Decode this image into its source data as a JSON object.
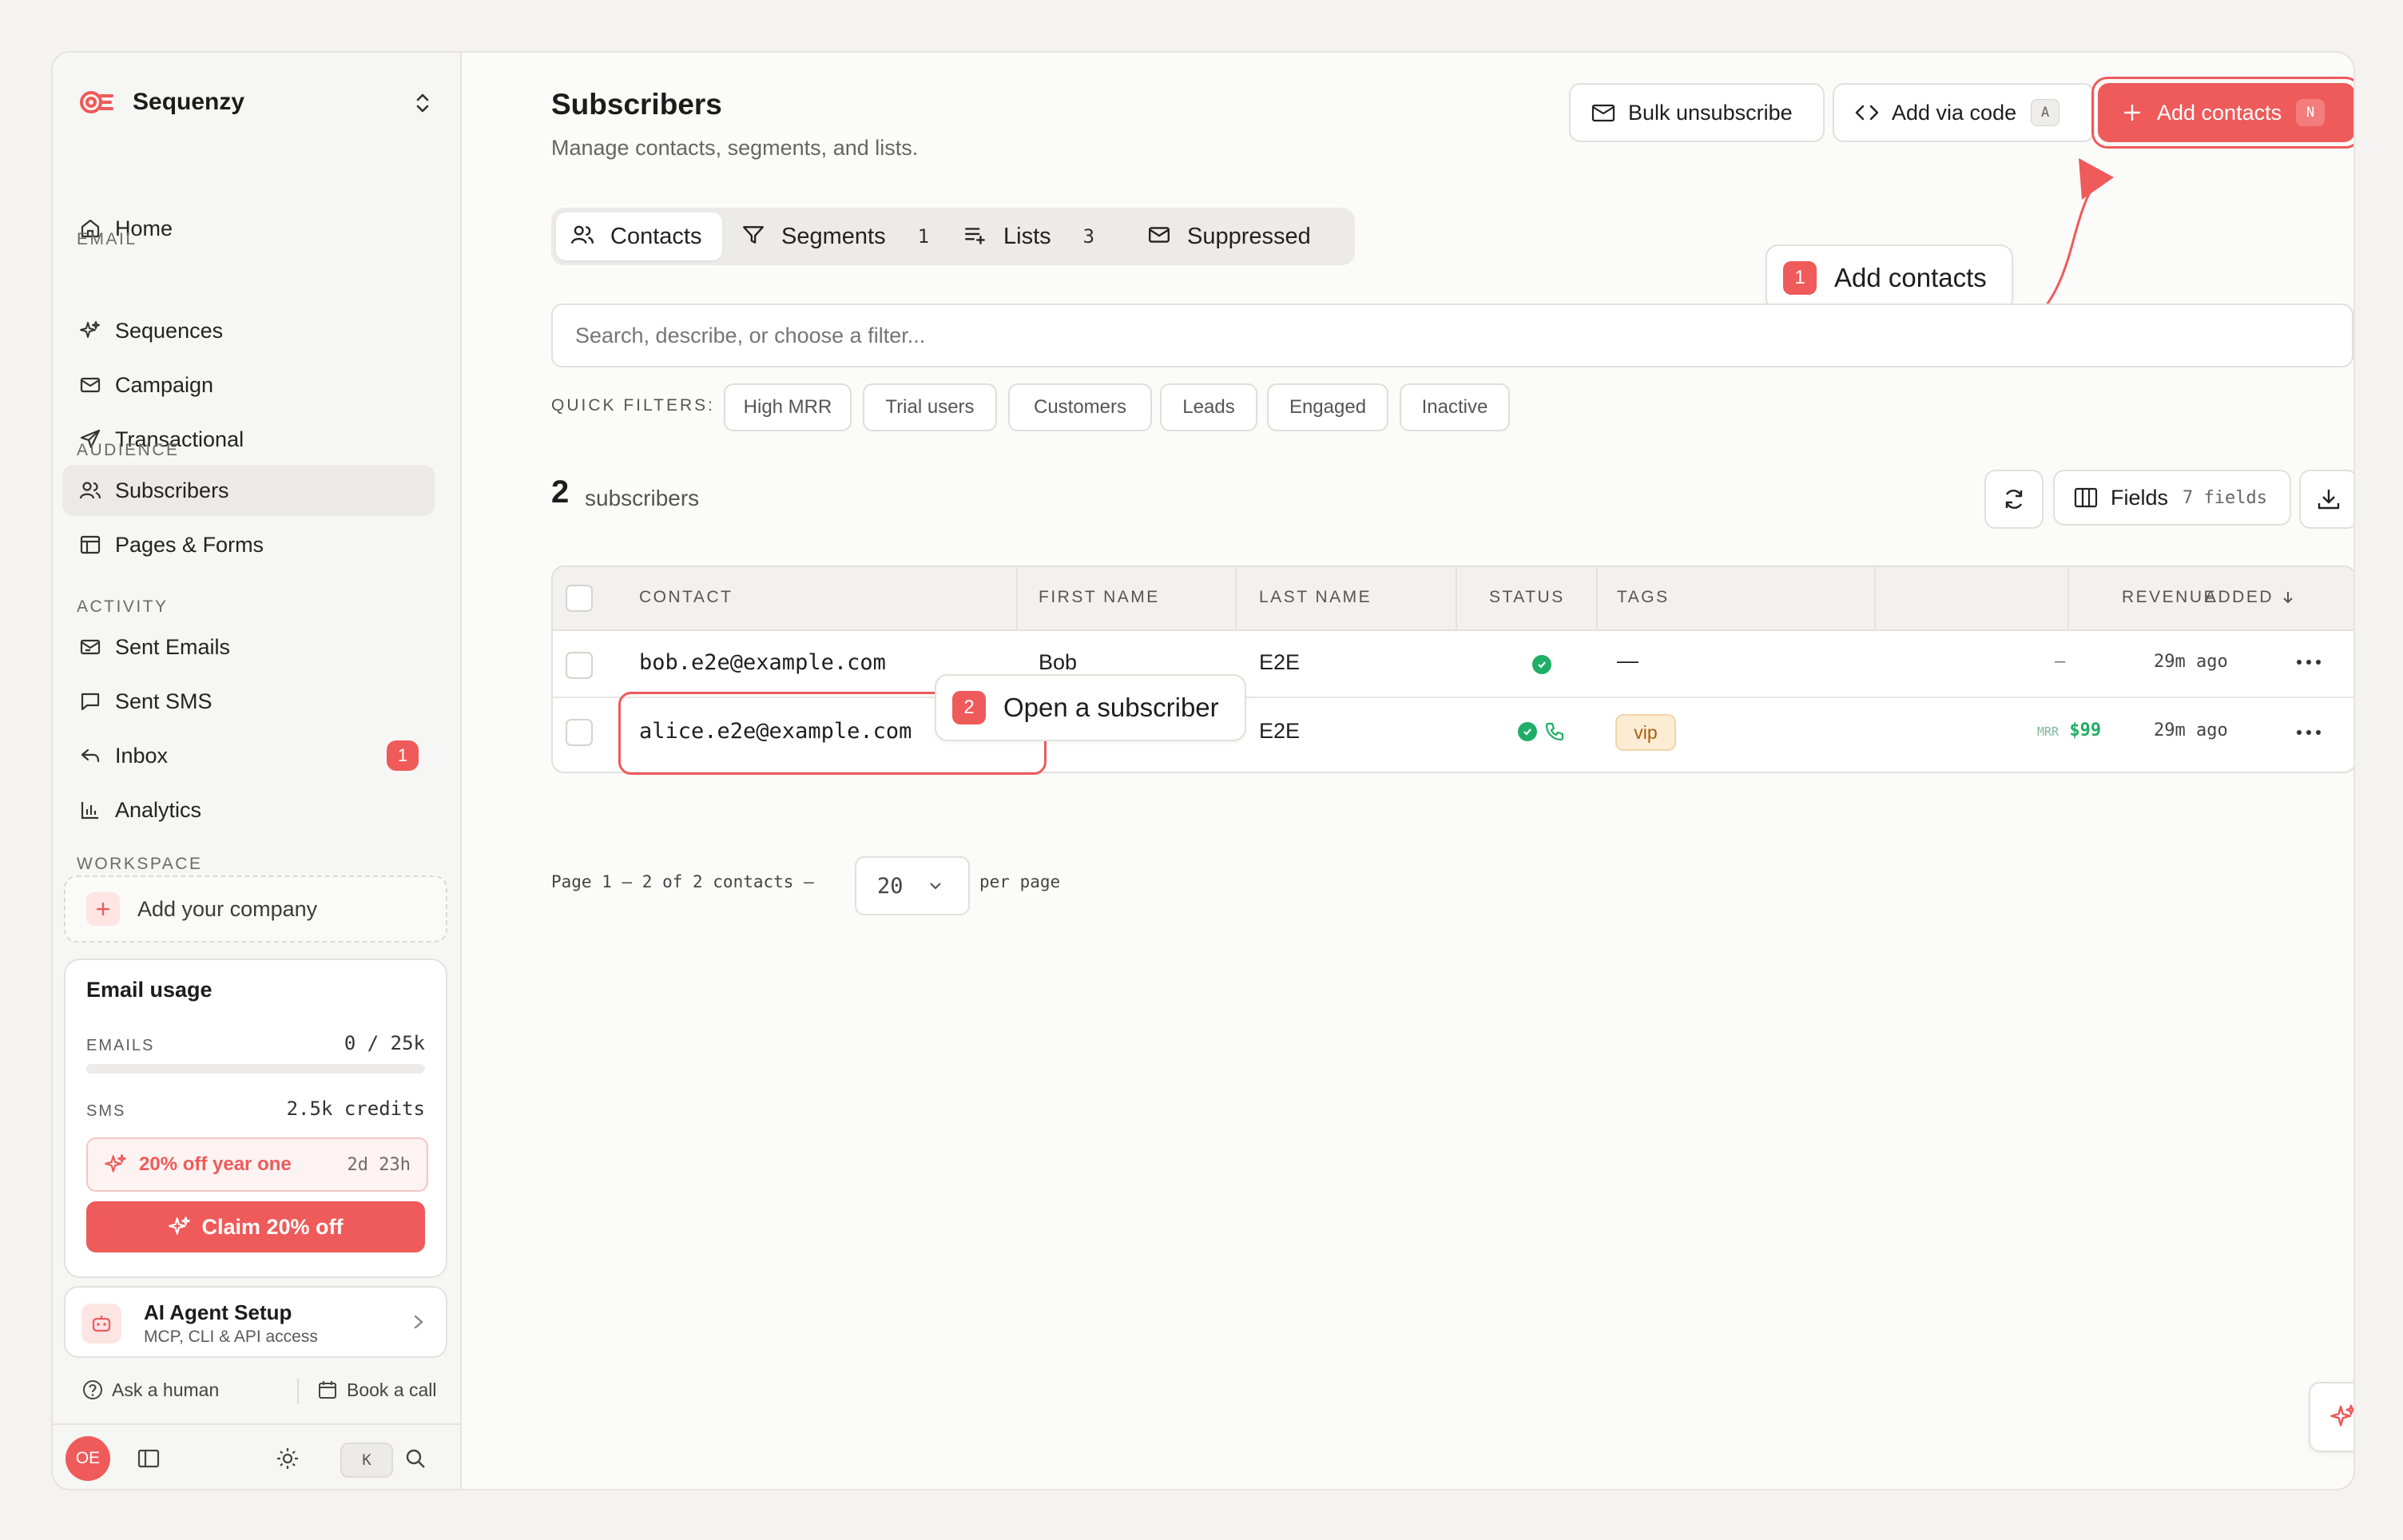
{
  "sidebar": {
    "brand": "Sequenzy",
    "home_label": "Home",
    "sections": [
      "EMAIL",
      "AUDIENCE",
      "ACTIVITY",
      "WORKSPACE"
    ],
    "email_items": [
      "Sequences",
      "Campaign",
      "Transactional"
    ],
    "audience_items": [
      "Subscribers",
      "Pages & Forms"
    ],
    "activity_items": [
      "Sent Emails",
      "Sent SMS",
      "Inbox",
      "Analytics"
    ],
    "inbox_badge": "1",
    "active_item": "Subscribers",
    "add_company": "Add your company",
    "usage": {
      "title": "Email usage",
      "emails_label": "EMAILS",
      "emails_value": "0 / 25k",
      "emails_progress": 0,
      "sms_label": "SMS",
      "sms_value": "2.5k credits",
      "promo_text": "20% off year one",
      "promo_timer": "2d 23h",
      "claim_label": "Claim 20% off"
    },
    "ai_setup": {
      "title": "AI Agent Setup",
      "subtitle": "MCP, CLI & API access"
    },
    "ask_human": "Ask a human",
    "book_call": "Book a call",
    "avatar": "OE",
    "kbd_hint": "K"
  },
  "header": {
    "title": "Subscribers",
    "subtitle": "Manage contacts, segments, and lists.",
    "bulk_unsubscribe": "Bulk unsubscribe",
    "add_via_code": "Add via code",
    "add_via_code_key": "A",
    "add_contacts": "Add contacts",
    "add_contacts_key": "N"
  },
  "tabs": [
    {
      "label": "Contacts",
      "count": ""
    },
    {
      "label": "Segments",
      "count": "1"
    },
    {
      "label": "Lists",
      "count": "3"
    },
    {
      "label": "Suppressed",
      "count": ""
    }
  ],
  "callouts": {
    "one_num": "1",
    "one_text": "Add contacts",
    "two_num": "2",
    "two_text": "Open a subscriber"
  },
  "search": {
    "placeholder": "Search, describe, or choose a filter..."
  },
  "quick_filters": {
    "label": "QUICK FILTERS:",
    "items": [
      "High MRR",
      "Trial users",
      "Customers",
      "Leads",
      "Engaged",
      "Inactive"
    ]
  },
  "summary": {
    "count": "2",
    "label": "subscribers"
  },
  "fields": {
    "label": "Fields",
    "count": "7 fields"
  },
  "table": {
    "columns": [
      "CONTACT",
      "FIRST NAME",
      "LAST NAME",
      "STATUS",
      "TAGS",
      "REVENUE",
      "ADDED"
    ],
    "rows": [
      {
        "contact": "bob.e2e@example.com",
        "first_name": "Bob",
        "last_name": "E2E",
        "tags": "—",
        "revenue_prefix": "",
        "revenue": "–",
        "added": "29m ago"
      },
      {
        "contact": "alice.e2e@example.com",
        "first_name": "",
        "last_name": "E2E",
        "tags": "vip",
        "revenue_prefix": "MRR",
        "revenue": "$99",
        "added": "29m ago"
      }
    ]
  },
  "pagination": {
    "text": "Page 1 – 2 of 2 contacts –",
    "per_page_value": "20",
    "per_page_label": "per page"
  },
  "colors": {
    "accent": "#ef5a5a",
    "success": "#1fae66",
    "tag_bg": "#fcecd4"
  }
}
